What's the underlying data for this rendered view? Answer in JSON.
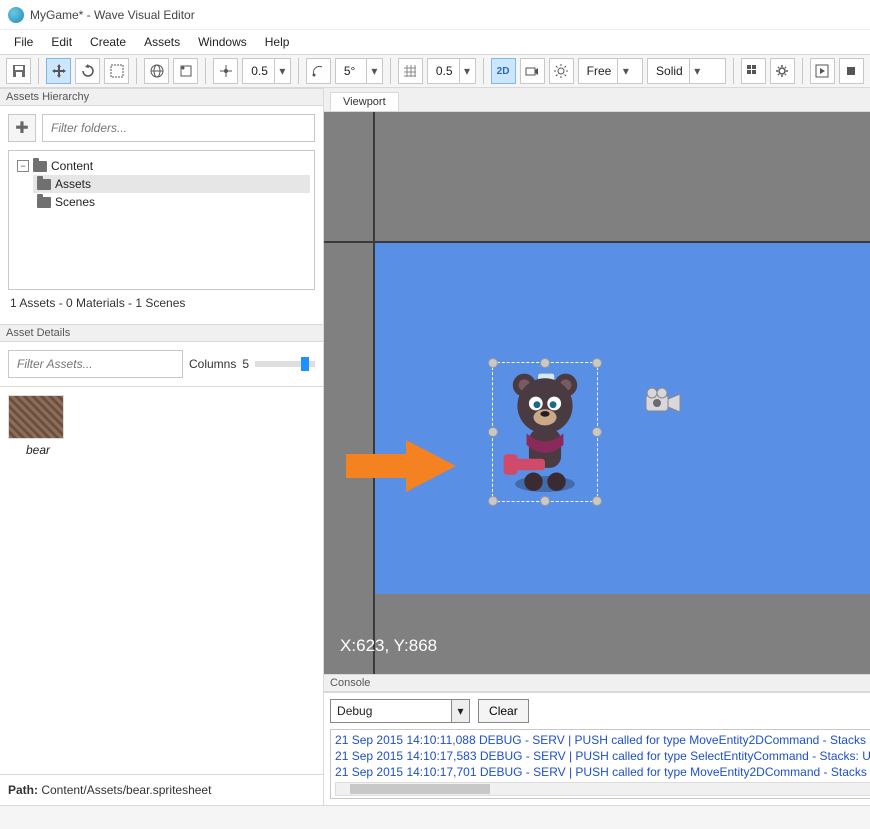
{
  "window": {
    "title": "MyGame* - Wave Visual Editor"
  },
  "menu": [
    "File",
    "Edit",
    "Create",
    "Assets",
    "Windows",
    "Help"
  ],
  "toolbar": {
    "scale": "0.5",
    "angle": "5°",
    "grid": "0.5",
    "mode2d": "2D",
    "camera": "Free",
    "shading": "Solid"
  },
  "hierarchy": {
    "label": "Assets Hierarchy",
    "filter_placeholder": "Filter folders...",
    "root": "Content",
    "children": [
      "Assets",
      "Scenes"
    ],
    "status": "1 Assets - 0 Materials - 1 Scenes"
  },
  "details": {
    "label": "Asset Details",
    "filter_placeholder": "Filter Assets...",
    "columns_label": "Columns",
    "columns_value": "5",
    "asset_name": "bear",
    "path_label": "Path:",
    "path_value": "Content/Assets/bear.spritesheet"
  },
  "viewport": {
    "tab": "Viewport",
    "coords": "X:623, Y:868"
  },
  "console": {
    "label": "Console",
    "level": "Debug",
    "clear": "Clear",
    "lines": [
      "21 Sep 2015 14:10:11,088 DEBUG - SERV   | PUSH called for type MoveEntity2DCommand - Stacks",
      "21 Sep 2015 14:10:17,583 DEBUG - SERV   | PUSH called for type SelectEntityCommand - Stacks: U",
      "21 Sep 2015 14:10:17,701 DEBUG - SERV   | PUSH called for type MoveEntity2DCommand - Stacks"
    ]
  }
}
